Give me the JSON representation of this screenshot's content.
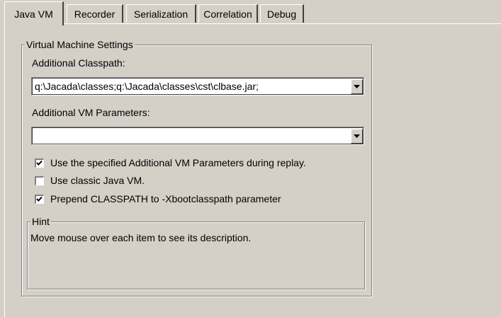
{
  "tabs": [
    {
      "label": "Java VM",
      "active": true
    },
    {
      "label": "Recorder",
      "active": false
    },
    {
      "label": "Serialization",
      "active": false
    },
    {
      "label": "Correlation",
      "active": false
    },
    {
      "label": "Debug",
      "active": false
    }
  ],
  "vm_settings": {
    "group_title": "Virtual Machine Settings",
    "classpath_label": "Additional Classpath:",
    "classpath_value": "q:\\Jacada\\classes;q:\\Jacada\\classes\\cst\\clbase.jar;",
    "vm_params_label": "Additional VM Parameters:",
    "vm_params_value": "",
    "checkboxes": [
      {
        "label": "Use the specified Additional VM Parameters during replay.",
        "checked": true
      },
      {
        "label": "Use classic Java VM.",
        "checked": false
      },
      {
        "label": "Prepend CLASSPATH to -Xbootclasspath parameter",
        "checked": true
      }
    ]
  },
  "hint": {
    "title": "Hint",
    "text": "Move mouse over each item to see its description."
  }
}
